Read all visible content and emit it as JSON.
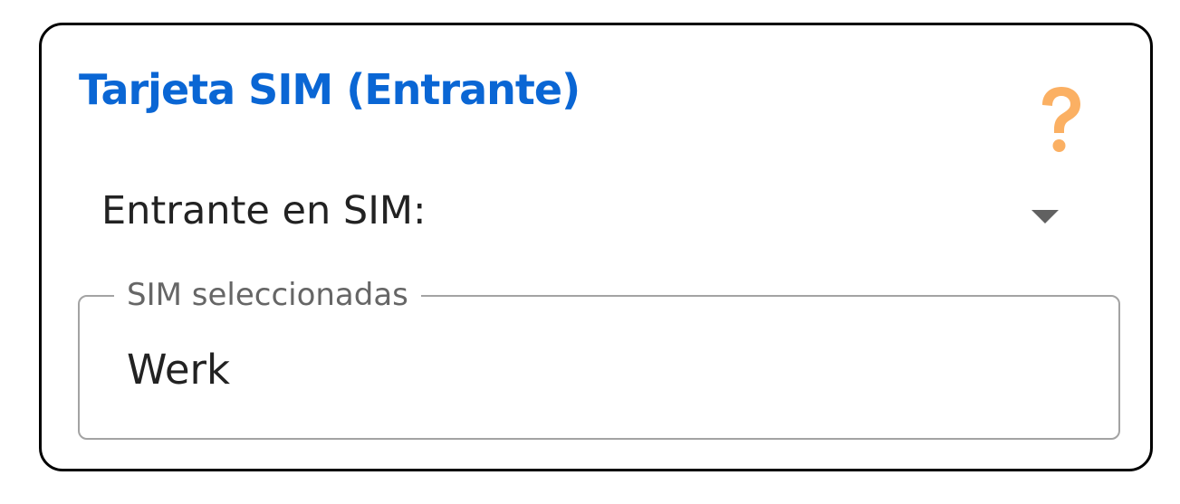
{
  "card": {
    "title": "Tarjeta SIM (Entrante)",
    "help_icon": "question-mark-icon",
    "help_icon_color": "#fbb063",
    "title_color": "#0a66d4"
  },
  "dropdown": {
    "label": "Entrante en SIM:",
    "arrow_icon": "caret-down-icon"
  },
  "sim_field": {
    "legend": "SIM seleccionadas",
    "value": "Werk"
  }
}
